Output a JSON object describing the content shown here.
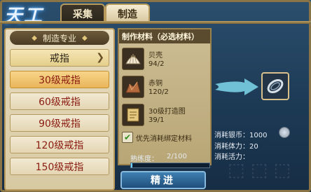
{
  "header": {
    "logo_text": "天工",
    "tabs": [
      {
        "label": "采集"
      },
      {
        "label": "制造"
      }
    ]
  },
  "left_panel": {
    "title": "制造专业",
    "category": "戒指",
    "items": [
      {
        "label": "30级戒指"
      },
      {
        "label": "60级戒指"
      },
      {
        "label": "90级戒指"
      },
      {
        "label": "120级戒指"
      },
      {
        "label": "150级戒指"
      }
    ]
  },
  "materials": {
    "title": "制作材料（必选材料）",
    "items": [
      {
        "name": "贝壳",
        "count": "94/2",
        "icon": "shell-icon"
      },
      {
        "name": "赤铜",
        "count": "120/2",
        "icon": "copper-ore-icon"
      },
      {
        "name": "30级打造图",
        "count": "39/1",
        "icon": "blueprint-scroll-icon"
      }
    ],
    "priority_label": "优先消耗绑定材料",
    "priority_checked": true
  },
  "proficiency": {
    "label": "熟练度：",
    "value": "2/100",
    "fraction": 0.02
  },
  "action": {
    "label": "精进"
  },
  "costs": {
    "silver": "消耗银币：1000",
    "stamina": "消耗体力：20",
    "vitality": "消耗活力："
  },
  "colors": {
    "panel_bg": "#d7c9a2",
    "accent_gold": "#b89b5c",
    "text_red": "#8a1b10",
    "button_blue": "#3f7fb0"
  }
}
